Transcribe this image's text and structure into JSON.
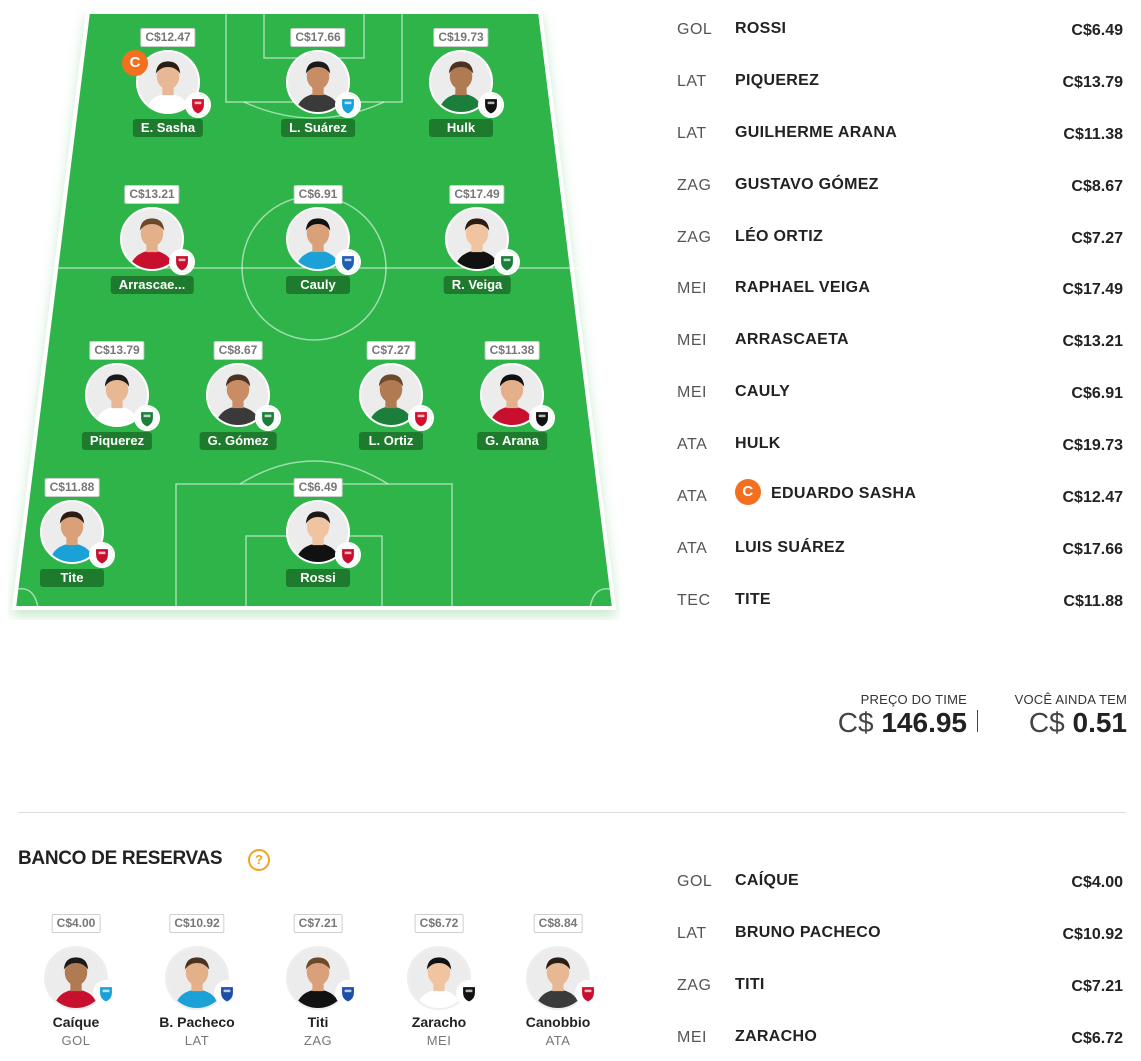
{
  "field": {
    "players": [
      {
        "short_name": "E. Sasha",
        "price": "C$12.47",
        "captain": true,
        "captain_label": "C",
        "club_badge": "red-bull-bragantino-badge",
        "badge_color": "#d2102a"
      },
      {
        "short_name": "L. Suárez",
        "price": "C$17.66",
        "captain": false,
        "club_badge": "gremio-badge",
        "badge_color": "#1aa2d8"
      },
      {
        "short_name": "Hulk",
        "price": "C$19.73",
        "captain": false,
        "club_badge": "atletico-mineiro-badge",
        "badge_color": "#111111"
      },
      {
        "short_name": "Arrascae...",
        "price": "C$13.21",
        "captain": false,
        "club_badge": "flamengo-badge",
        "badge_color": "#c8102e"
      },
      {
        "short_name": "Cauly",
        "price": "C$6.91",
        "captain": false,
        "club_badge": "bahia-badge",
        "badge_color": "#1c5fb4"
      },
      {
        "short_name": "R. Veiga",
        "price": "C$17.49",
        "captain": false,
        "club_badge": "palmeiras-badge",
        "badge_color": "#1b7f3b"
      },
      {
        "short_name": "Piquerez",
        "price": "C$13.79",
        "captain": false,
        "club_badge": "palmeiras-badge",
        "badge_color": "#1b7f3b"
      },
      {
        "short_name": "G. Gómez",
        "price": "C$8.67",
        "captain": false,
        "club_badge": "palmeiras-badge",
        "badge_color": "#1b7f3b"
      },
      {
        "short_name": "L. Ortiz",
        "price": "C$7.27",
        "captain": false,
        "club_badge": "red-bull-bragantino-badge",
        "badge_color": "#d2102a"
      },
      {
        "short_name": "G. Arana",
        "price": "C$11.38",
        "captain": false,
        "club_badge": "atletico-mineiro-badge",
        "badge_color": "#111111"
      },
      {
        "short_name": "Tite",
        "price": "C$11.88",
        "captain": false,
        "club_badge": "flamengo-badge",
        "badge_color": "#c8102e"
      },
      {
        "short_name": "Rossi",
        "price": "C$6.49",
        "captain": false,
        "club_badge": "flamengo-badge",
        "badge_color": "#c8102e"
      }
    ]
  },
  "lineup": [
    {
      "pos": "GOL",
      "name": "ROSSI",
      "price": "C$6.49",
      "captain": false
    },
    {
      "pos": "LAT",
      "name": "PIQUEREZ",
      "price": "C$13.79",
      "captain": false
    },
    {
      "pos": "LAT",
      "name": "GUILHERME ARANA",
      "price": "C$11.38",
      "captain": false
    },
    {
      "pos": "ZAG",
      "name": "GUSTAVO GÓMEZ",
      "price": "C$8.67",
      "captain": false
    },
    {
      "pos": "ZAG",
      "name": "LÉO ORTIZ",
      "price": "C$7.27",
      "captain": false
    },
    {
      "pos": "MEI",
      "name": "RAPHAEL VEIGA",
      "price": "C$17.49",
      "captain": false
    },
    {
      "pos": "MEI",
      "name": "ARRASCAETA",
      "price": "C$13.21",
      "captain": false
    },
    {
      "pos": "MEI",
      "name": "CAULY",
      "price": "C$6.91",
      "captain": false
    },
    {
      "pos": "ATA",
      "name": "HULK",
      "price": "C$19.73",
      "captain": false
    },
    {
      "pos": "ATA",
      "name": "EDUARDO SASHA",
      "price": "C$12.47",
      "captain": true,
      "captain_label": "C"
    },
    {
      "pos": "ATA",
      "name": "LUIS SUÁREZ",
      "price": "C$17.66",
      "captain": false
    },
    {
      "pos": "TEC",
      "name": "TITE",
      "price": "C$11.88",
      "captain": false
    }
  ],
  "totals": {
    "team_price_label": "PREÇO DO TIME",
    "team_price_currency": "C$",
    "team_price_value": "146.95",
    "remaining_label": "VOCÊ AINDA TEM",
    "remaining_currency": "C$",
    "remaining_value": "0.51"
  },
  "bench": {
    "title": "BANCO DE RESERVAS",
    "help_label": "?",
    "players": [
      {
        "short_name": "Caíque",
        "pos": "GOL",
        "price": "C$4.00",
        "club_badge": "gremio-badge",
        "badge_color": "#1aa2d8"
      },
      {
        "short_name": "B. Pacheco",
        "pos": "LAT",
        "price": "C$10.92",
        "club_badge": "fortaleza-badge",
        "badge_color": "#1c4fa8"
      },
      {
        "short_name": "Titi",
        "pos": "ZAG",
        "price": "C$7.21",
        "club_badge": "fortaleza-badge",
        "badge_color": "#1c4fa8"
      },
      {
        "short_name": "Zaracho",
        "pos": "MEI",
        "price": "C$6.72",
        "club_badge": "atletico-mineiro-badge",
        "badge_color": "#111111"
      },
      {
        "short_name": "Canobbio",
        "pos": "ATA",
        "price": "C$8.84",
        "club_badge": "athletico-paranaense-badge",
        "badge_color": "#c8102e"
      }
    ],
    "list": [
      {
        "pos": "GOL",
        "name": "CAÍQUE",
        "price": "C$4.00"
      },
      {
        "pos": "LAT",
        "name": "BRUNO PACHECO",
        "price": "C$10.92"
      },
      {
        "pos": "ZAG",
        "name": "TITI",
        "price": "C$7.21"
      },
      {
        "pos": "MEI",
        "name": "ZARACHO",
        "price": "C$6.72"
      }
    ]
  },
  "colors": {
    "pitch_green": "#2eb44a",
    "pitch_dark": "#1e7a2c",
    "captain_orange": "#f37021",
    "help_orange": "#f3a321"
  }
}
